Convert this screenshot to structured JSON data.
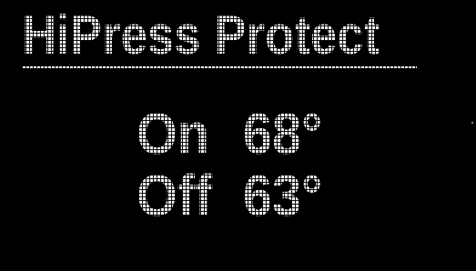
{
  "screen": {
    "title": "HiPress Protect",
    "on": {
      "label": "On",
      "value": "68°"
    },
    "off": {
      "label": "Off",
      "value": "63°"
    },
    "text_color": "#f2f2f2",
    "background_color": "#000000"
  }
}
